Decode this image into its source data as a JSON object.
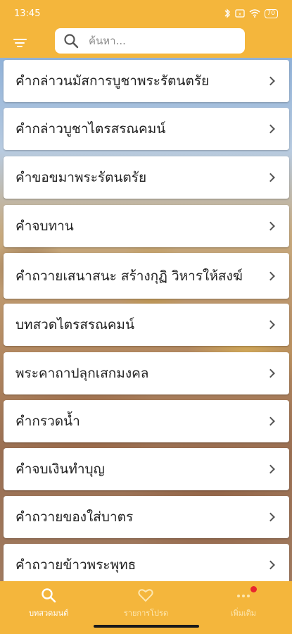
{
  "status_bar": {
    "time": "13:45",
    "battery": "70"
  },
  "header": {
    "search_placeholder": "ค้นหา..."
  },
  "list_items": [
    {
      "label": "คำกล่าวนมัสการบูชาพระรัตนตรัย"
    },
    {
      "label": "คำกล่าวบูชาไตรสรณคมน์"
    },
    {
      "label": "คำขอขมาพระรัตนตรัย"
    },
    {
      "label": "คำจบทาน"
    },
    {
      "label": "คำถวายเสนาสนะ สร้างกุฏิ วิหารให้สงฆ์"
    },
    {
      "label": "บทสวดไตรสรณคมน์"
    },
    {
      "label": "พระคาถาปลุกเสกมงคล"
    },
    {
      "label": "คำกรวดน้ำ"
    },
    {
      "label": "คำจบเงินทำบุญ"
    },
    {
      "label": "คำถวายของใส่บาตร"
    },
    {
      "label": "คำถวายข้าวพระพุทธ"
    }
  ],
  "bottom_nav": [
    {
      "label": "บทสวดมนต์",
      "icon": "search-icon",
      "active": true
    },
    {
      "label": "รายการโปรด",
      "icon": "heart-icon",
      "active": false
    },
    {
      "label": "เพิ่มเติม",
      "icon": "more-icon",
      "active": false
    }
  ],
  "colors": {
    "primary": "#f4b63c",
    "badge": "#e8262e"
  }
}
